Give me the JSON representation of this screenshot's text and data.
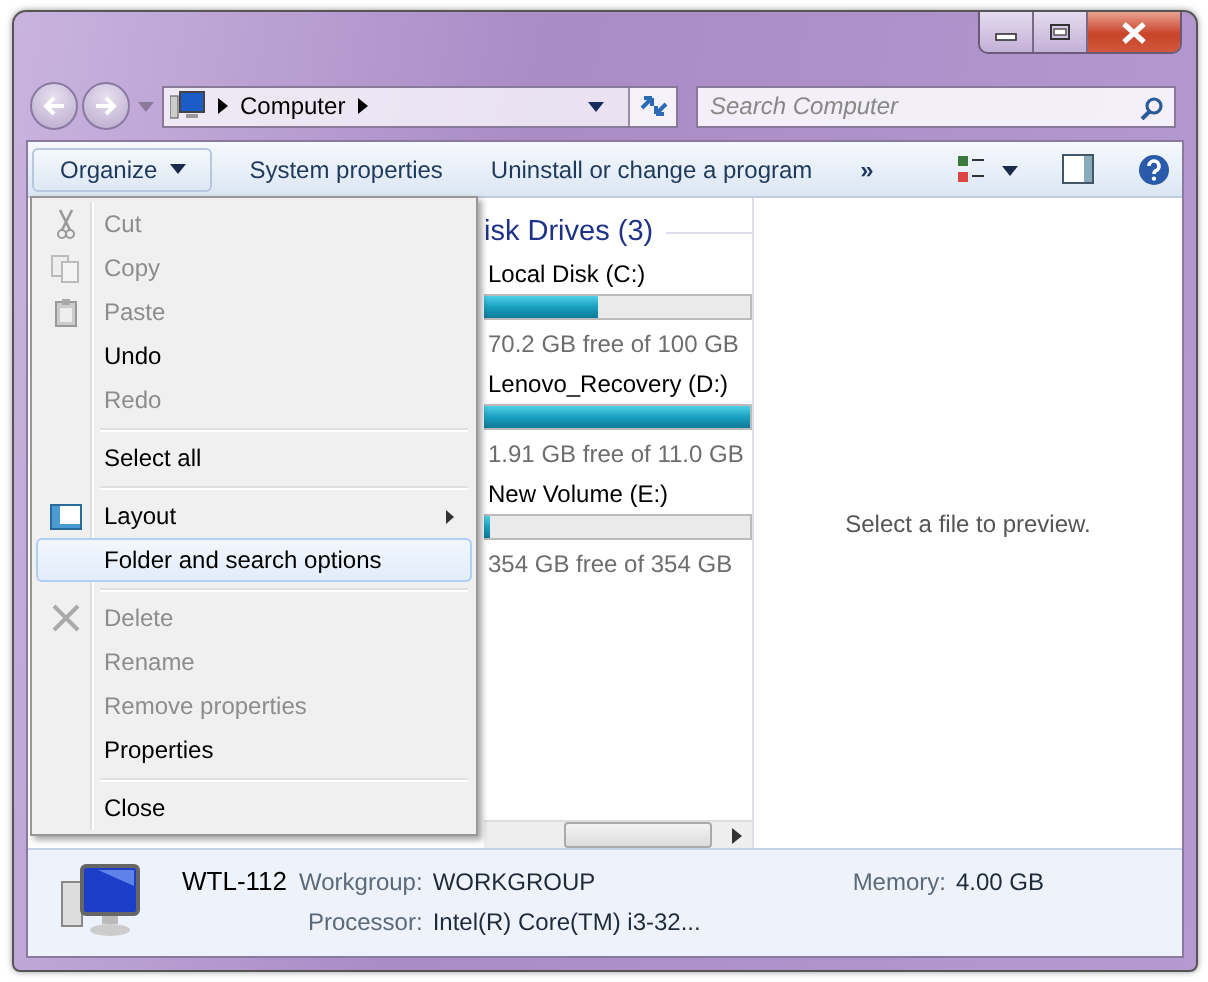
{
  "address": {
    "crumbs": [
      "Computer"
    ]
  },
  "search": {
    "placeholder": "Search Computer"
  },
  "toolbar": {
    "organize": "Organize",
    "buttons": [
      "System properties",
      "Uninstall or change a program"
    ],
    "more": "»"
  },
  "drives": {
    "header": "isk Drives (3)",
    "items": [
      {
        "name": "Local Disk (C:)",
        "level": 0.43,
        "free": "70.2 GB free of 100 GB"
      },
      {
        "name": "Lenovo_Recovery (D:)",
        "level": 1.0,
        "free": "1.91 GB free of 11.0 GB"
      },
      {
        "name": "New Volume (E:)",
        "level": 0.02,
        "free": "354 GB free of 354 GB"
      }
    ]
  },
  "preview": {
    "message": "Select a file to preview."
  },
  "menu": [
    {
      "kind": "item",
      "label": "Cut",
      "disabled": true,
      "selected": false
    },
    {
      "kind": "item",
      "label": "Copy",
      "disabled": true,
      "selected": false
    },
    {
      "kind": "item",
      "label": "Paste",
      "disabled": true,
      "selected": false
    },
    {
      "kind": "item",
      "label": "Undo",
      "disabled": false,
      "selected": false
    },
    {
      "kind": "item",
      "label": "Redo",
      "disabled": true,
      "selected": false
    },
    {
      "kind": "separator"
    },
    {
      "kind": "item",
      "label": "Select all",
      "disabled": false,
      "selected": false
    },
    {
      "kind": "separator"
    },
    {
      "kind": "submenu",
      "label": "Layout",
      "disabled": false,
      "selected": false
    },
    {
      "kind": "item",
      "label": "Folder and search options",
      "disabled": false,
      "selected": true
    },
    {
      "kind": "separator"
    },
    {
      "kind": "item",
      "label": "Delete",
      "disabled": true,
      "selected": false
    },
    {
      "kind": "item",
      "label": "Rename",
      "disabled": true,
      "selected": false
    },
    {
      "kind": "item",
      "label": "Remove properties",
      "disabled": true,
      "selected": false
    },
    {
      "kind": "item",
      "label": "Properties",
      "disabled": false,
      "selected": false
    },
    {
      "kind": "separator"
    },
    {
      "kind": "item",
      "label": "Close",
      "disabled": false,
      "selected": false
    }
  ],
  "details": {
    "name": "WTL-112",
    "fields": [
      {
        "label": "Workgroup:",
        "value": "WORKGROUP"
      },
      {
        "label": "Memory:",
        "value": "4.00 GB"
      },
      {
        "label": "Processor:",
        "value": "Intel(R) Core(TM) i3-32..."
      }
    ]
  }
}
